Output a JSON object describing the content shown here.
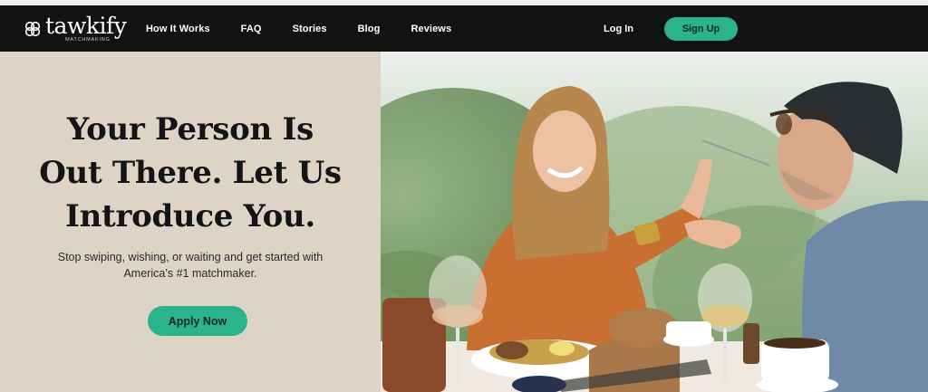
{
  "brand": {
    "name": "tawkify",
    "tagline": "MATCHMAKING",
    "colors": {
      "nav_bg": "#121212",
      "accent": "#2bb38e",
      "hero_bg": "#ddd4c6"
    }
  },
  "nav": {
    "links": [
      "How It Works",
      "FAQ",
      "Stories",
      "Blog",
      "Reviews"
    ],
    "login_label": "Log In",
    "signup_label": "Sign Up"
  },
  "hero": {
    "headline_lines": [
      "Your Person Is",
      "Out There. Let Us",
      "Introduce You."
    ],
    "subtext_lines": [
      "Stop swiping, wishing, or waiting and get started with",
      "America’s #1 matchmaker."
    ],
    "cta_label": "Apply Now",
    "image_icon": "couple-dining-photo"
  }
}
